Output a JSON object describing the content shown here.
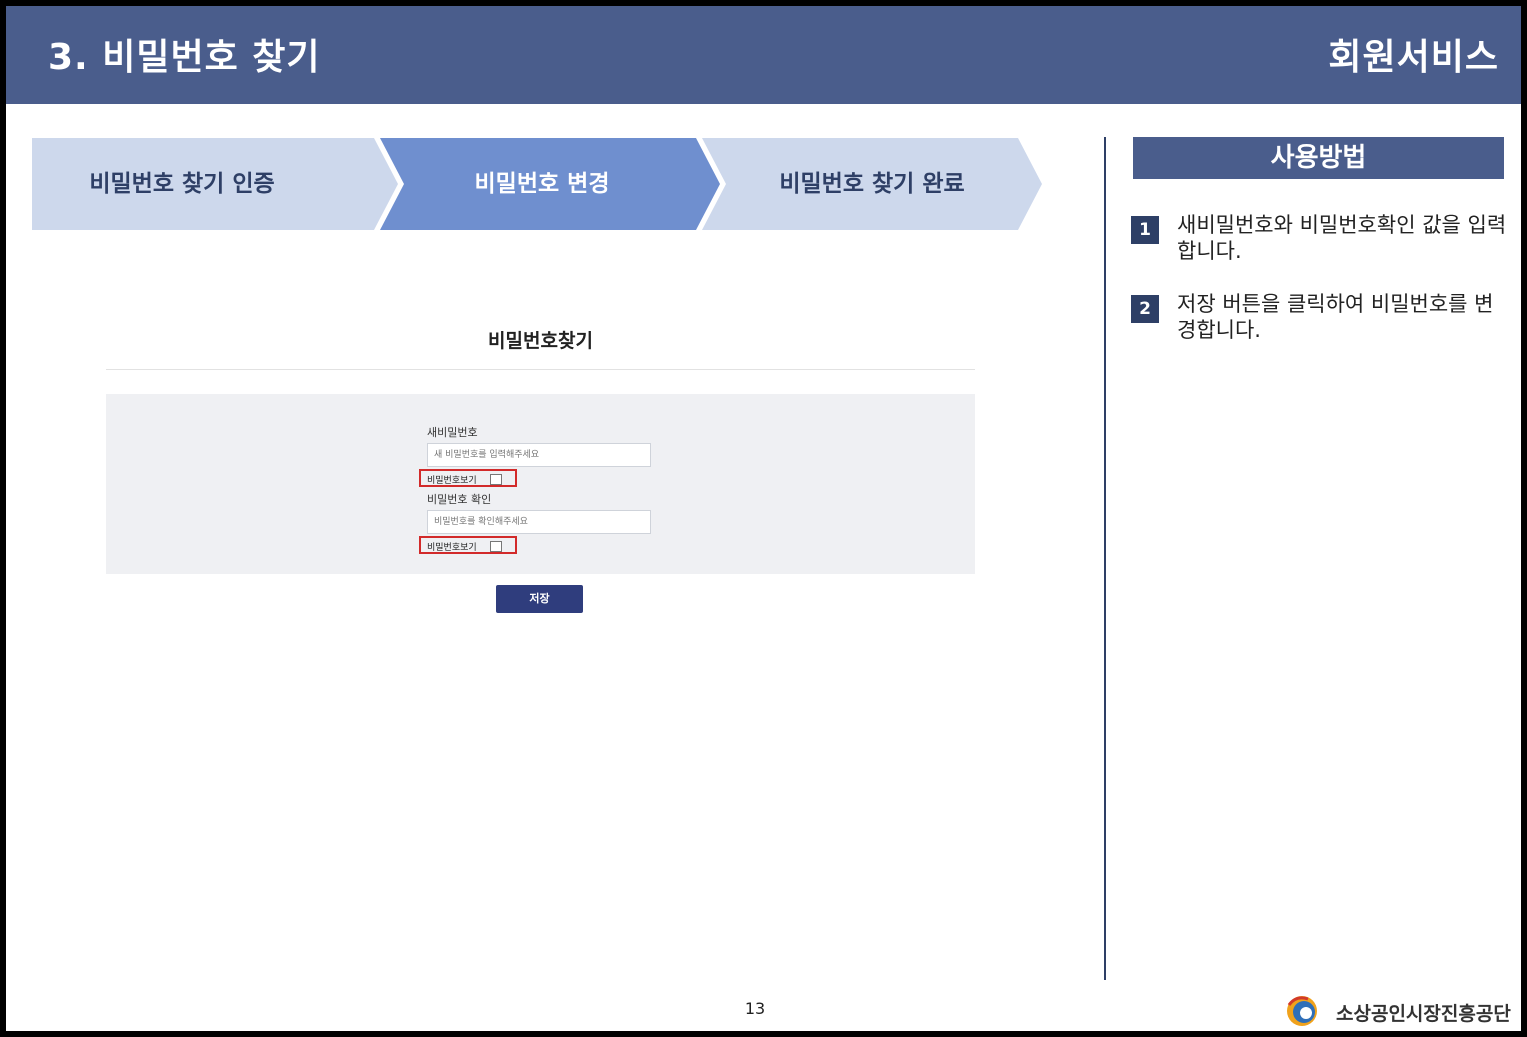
{
  "header": {
    "title": "3. 비밀번호 찾기",
    "section": "회원서비스",
    "color": "#4a5d8c"
  },
  "steps": [
    {
      "label": "비밀번호 찾기 인증",
      "state": "inactive"
    },
    {
      "label": "비밀번호 변경",
      "state": "active"
    },
    {
      "label": "비밀번호 찾기 완료",
      "state": "inactive"
    }
  ],
  "form": {
    "title": "비밀번호찾기",
    "new_password_label": "새비밀번호",
    "new_password_placeholder": "새 비밀번호를 입력해주세요",
    "show_password_label": "비밀번호보기",
    "confirm_label": "비밀번호 확인",
    "confirm_placeholder": "비밀번호를 확인해주세요",
    "save_label": "저장"
  },
  "howto": {
    "title": "사용방법",
    "items": [
      {
        "num": "1",
        "text": "새비밀번호와 비밀번호확인 값을 입력합니다."
      },
      {
        "num": "2",
        "text": "저장 버튼을 클릭하여 비밀번호를 변경합니다."
      }
    ]
  },
  "footer": {
    "page_number": "13",
    "org_name": "소상공인시장진흥공단"
  },
  "colors": {
    "accent": "#4a5d8c",
    "step_active": "#6f8fcf",
    "step_inactive": "#cdd8ec",
    "highlight": "#d22a2a",
    "button": "#2f3d7d"
  }
}
